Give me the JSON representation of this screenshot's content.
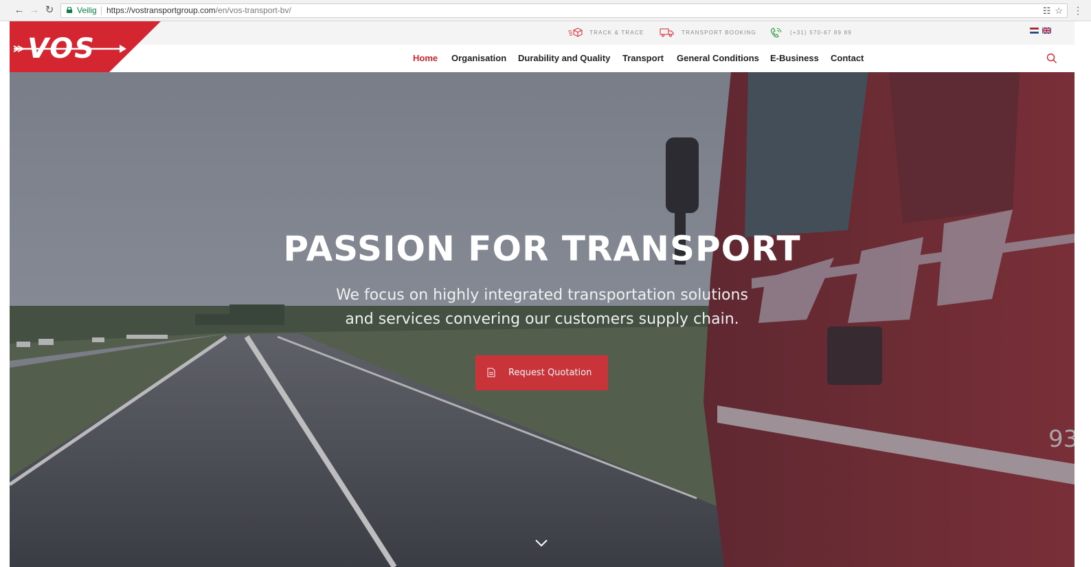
{
  "browser": {
    "security_label": "Veilig",
    "url_domain": "https://vostransportgroup.com",
    "url_path": "/en/vos-transport-bv/",
    "back_icon": "arrow-left-icon",
    "forward_icon": "arrow-right-icon",
    "reload_icon": "reload-icon"
  },
  "topbar": {
    "track_trace": "TRACK & TRACE",
    "transport_booking": "TRANSPORT BOOKING",
    "phone": "(+31) 570-67 89 89"
  },
  "logo": {
    "text": "VOS"
  },
  "nav": {
    "items": [
      "Home",
      "Organisation",
      "Durability and Quality",
      "Transport",
      "General Conditions",
      "E-Business",
      "Contact"
    ],
    "active": "Home"
  },
  "hero": {
    "title": "PASSION FOR TRANSPORT",
    "subtitle_line1": "We focus on highly integrated transportation solutions",
    "subtitle_line2": "and services convering our customers supply chain.",
    "cta_label": "Request Quotation",
    "truck_number": "93"
  },
  "colors": {
    "brand_red": "#d32630",
    "text_dark": "#222222"
  }
}
